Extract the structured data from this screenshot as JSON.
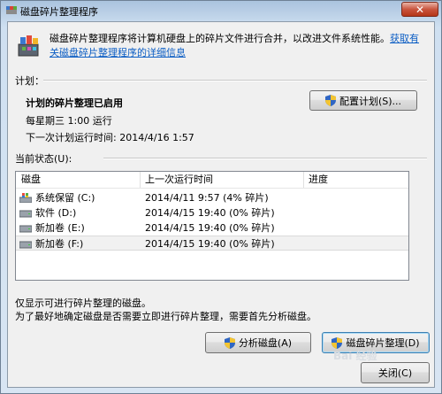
{
  "window": {
    "title": "磁盘碎片整理程序",
    "close_label": "✕"
  },
  "intro": {
    "text": "磁盘碎片整理程序将计算机硬盘上的碎片文件进行合并，以改进文件系统性能。",
    "link": "获取有关磁盘碎片整理程序的详细信息"
  },
  "schedule": {
    "group_label": "计划：",
    "status": "计划的碎片整理已启用",
    "frequency": "每星期三  1:00 运行",
    "next_run": "下一次计划运行时间: 2014/4/16 1:57",
    "configure_button": "配置计划(S)..."
  },
  "current_status": {
    "group_label": "当前状态(U):",
    "columns": [
      "磁盘",
      "上一次运行时间",
      "进度"
    ],
    "disks": [
      {
        "name": "系统保留 (C:)",
        "last_run": "2014/4/11 9:57 (4% 碎片)",
        "icon": "system-drive-icon"
      },
      {
        "name": "软件 (D:)",
        "last_run": "2014/4/15 19:40 (0% 碎片)",
        "icon": "hard-drive-icon"
      },
      {
        "name": "新加卷 (E:)",
        "last_run": "2014/4/15 19:40 (0% 碎片)",
        "icon": "hard-drive-icon"
      },
      {
        "name": "新加卷 (F:)",
        "last_run": "2014/4/15 19:40 (0% 碎片)",
        "icon": "hard-drive-icon"
      }
    ]
  },
  "notes": {
    "line1": "仅显示可进行碎片整理的磁盘。",
    "line2": "为了最好地确定磁盘是否需要立即进行碎片整理，需要首先分析磁盘。"
  },
  "buttons": {
    "analyze": "分析磁盘(A)",
    "defragment": "磁盘碎片整理(D)",
    "close": "关闭(C)"
  },
  "watermark": "Bai 经验",
  "colors": {
    "link": "#0d5ec4",
    "close_button": "#c9553e",
    "title_bar": "#aac3de"
  }
}
